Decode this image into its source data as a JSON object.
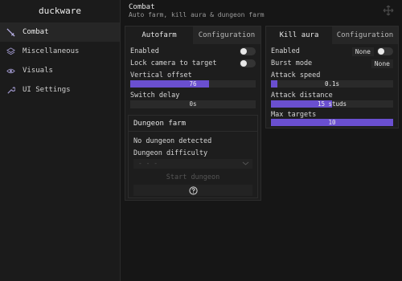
{
  "app": {
    "title": "duckware"
  },
  "sidebar": {
    "items": [
      {
        "label": "Combat",
        "icon": "sword-icon"
      },
      {
        "label": "Miscellaneous",
        "icon": "layers-icon"
      },
      {
        "label": "Visuals",
        "icon": "eye-icon"
      },
      {
        "label": "UI Settings",
        "icon": "wrench-icon"
      }
    ],
    "active": "Combat"
  },
  "header": {
    "title": "Combat",
    "subtitle": "Auto farm, kill aura & dungeon farm",
    "move_icon": "move-icon"
  },
  "autofarm": {
    "tabs": [
      "Autofarm",
      "Configuration"
    ],
    "enabled_label": "Enabled",
    "enabled_value": false,
    "lock_camera_label": "Lock camera to target",
    "lock_camera_value": false,
    "vertical_offset_label": "Vertical offset",
    "vertical_offset_value": "76",
    "vertical_offset_fraction": 0.63,
    "switch_delay_label": "Switch delay",
    "switch_delay_value": "0s"
  },
  "dungeon": {
    "title": "Dungeon farm",
    "status": "No dungeon detected",
    "difficulty_label": "Dungeon difficulty",
    "difficulty_value": "- - -",
    "start_label": "Start dungeon",
    "help_icon": "question-icon"
  },
  "killaura": {
    "tabs": [
      "Kill aura",
      "Configuration"
    ],
    "enabled_label": "Enabled",
    "enabled_key": "None",
    "enabled_value": false,
    "burst_label": "Burst mode",
    "burst_key": "None",
    "attack_speed_label": "Attack speed",
    "attack_speed_value": "0.1s",
    "attack_speed_fraction": 0.05,
    "attack_distance_label": "Attack distance",
    "attack_distance_value": "15 studs",
    "attack_distance_fraction": 0.5,
    "max_targets_label": "Max targets",
    "max_targets_value": "10",
    "max_targets_fraction": 1.0
  },
  "colors": {
    "accent": "#6a4fd0",
    "background": "#161616",
    "panel": "#1d1d1d"
  }
}
